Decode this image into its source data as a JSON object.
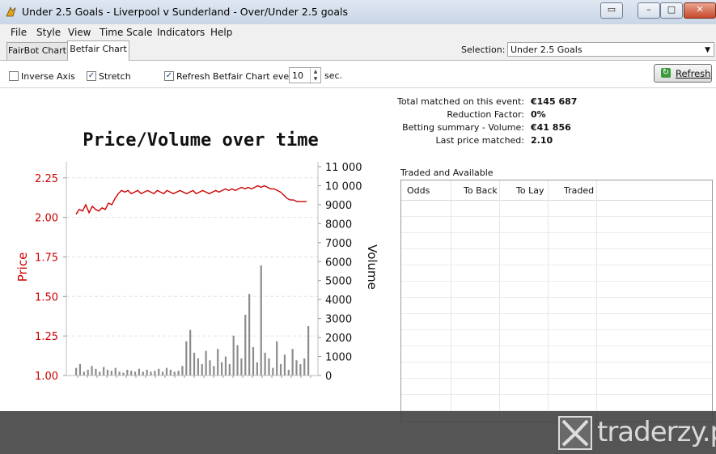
{
  "window": {
    "title": "Under 2.5 Goals - Liverpool v Sunderland - Over/Under 2.5 goals",
    "buttons": [
      "restore",
      "minimize",
      "maximize",
      "close"
    ]
  },
  "menu": [
    "File",
    "Style",
    "View",
    "Time Scale",
    "Indicators",
    "Help"
  ],
  "tabs": [
    {
      "label": "FairBot Chart",
      "active": false
    },
    {
      "label": "Betfair Chart",
      "active": true
    }
  ],
  "selection": {
    "label": "Selection:",
    "value": "Under 2.5 Goals"
  },
  "toolbar": {
    "inverse_axis": {
      "label": "Inverse Axis",
      "checked": false
    },
    "stretch": {
      "label": "Stretch",
      "checked": true
    },
    "refresh_every": {
      "label": "Refresh Betfair Chart every",
      "checked": true
    },
    "interval_value": "10",
    "interval_unit": "sec.",
    "refresh_button": "Refresh"
  },
  "stats": [
    {
      "label": "Total matched on this event:",
      "value": "€145 687"
    },
    {
      "label": "Reduction Factor:",
      "value": "0%"
    },
    {
      "label": "Betting summary - Volume:",
      "value": "€41 856"
    },
    {
      "label": "Last price matched:",
      "value": "2.10"
    }
  ],
  "traded_grid": {
    "title": "Traded and Available",
    "columns": [
      "Odds",
      "To Back",
      "To Lay",
      "Traded"
    ]
  },
  "watermark": "traderzy.pl",
  "colors": {
    "price_line": "#cc0000",
    "volume_bars": "#8c8c8c",
    "price_axis": "#cc0000"
  },
  "chart_data": {
    "type": "line",
    "title": "Price/Volume over time",
    "ylabel": "Price",
    "y2label": "Volume",
    "ylim": [
      1.0,
      2.3
    ],
    "y2lim": [
      0,
      11000
    ],
    "yticks": [
      "2.25",
      "2.00",
      "1.75",
      "1.50",
      "1.25",
      "1.00"
    ],
    "y2ticks": [
      "11 000",
      "10 000",
      "9000",
      "8000",
      "7000",
      "6000",
      "5000",
      "4000",
      "3000",
      "2000",
      "1000",
      "0"
    ],
    "price_series": [
      2.02,
      2.05,
      2.04,
      2.08,
      2.03,
      2.07,
      2.05,
      2.04,
      2.06,
      2.05,
      2.09,
      2.08,
      2.12,
      2.15,
      2.17,
      2.16,
      2.17,
      2.15,
      2.16,
      2.17,
      2.15,
      2.16,
      2.17,
      2.16,
      2.15,
      2.17,
      2.16,
      2.15,
      2.17,
      2.16,
      2.15,
      2.16,
      2.17,
      2.16,
      2.15,
      2.16,
      2.17,
      2.15,
      2.16,
      2.17,
      2.16,
      2.15,
      2.16,
      2.17,
      2.16,
      2.17,
      2.18,
      2.17,
      2.18,
      2.17,
      2.18,
      2.19,
      2.18,
      2.19,
      2.18,
      2.19,
      2.2,
      2.19,
      2.2,
      2.19,
      2.18,
      2.18,
      2.17,
      2.16,
      2.14,
      2.12,
      2.11,
      2.11,
      2.1,
      2.1,
      2.1,
      2.1
    ],
    "volume_series": [
      400,
      600,
      200,
      300,
      500,
      350,
      200,
      450,
      300,
      250,
      400,
      200,
      150,
      300,
      250,
      200,
      350,
      200,
      300,
      200,
      250,
      350,
      200,
      400,
      300,
      200,
      250,
      500,
      1800,
      2400,
      1200,
      900,
      600,
      1300,
      800,
      500,
      1400,
      700,
      1000,
      600,
      2100,
      1600,
      900,
      3200,
      4300,
      1500,
      700,
      5800,
      1200,
      900,
      400,
      1800,
      600,
      1100,
      300,
      1400,
      800,
      600,
      900,
      2600
    ]
  }
}
